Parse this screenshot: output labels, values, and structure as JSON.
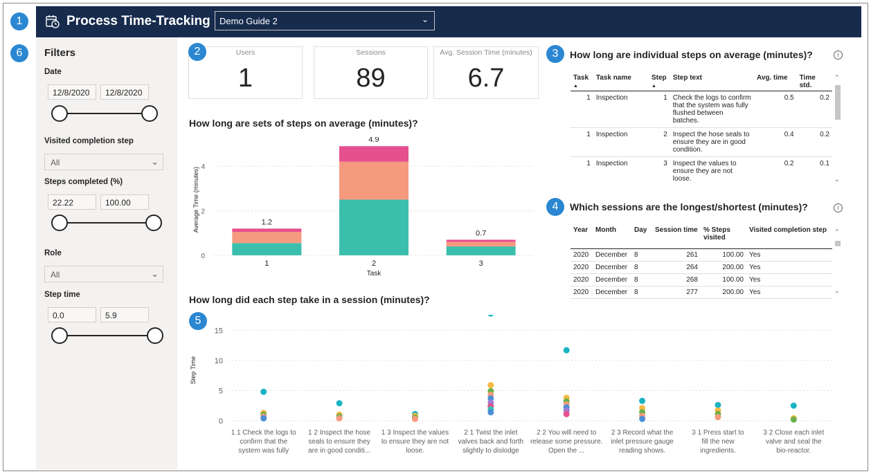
{
  "badges": [
    "1",
    "2",
    "3",
    "4",
    "5",
    "6"
  ],
  "header": {
    "title": "Process Time-Tracking",
    "guide_select": "Demo Guide 2",
    "icon": "calendar-clock-icon"
  },
  "filters": {
    "title": "Filters",
    "date": {
      "label": "Date",
      "from": "12/8/2020",
      "to": "12/8/2020"
    },
    "visited_completion_step": {
      "label": "Visited completion step",
      "value": "All"
    },
    "steps_completed": {
      "label": "Steps completed (%)",
      "from": "22.22",
      "to": "100.00"
    },
    "role": {
      "label": "Role",
      "value": "All"
    },
    "step_time": {
      "label": "Step time",
      "from": "0.0",
      "to": "5.9"
    }
  },
  "kpis": [
    {
      "label": "Users",
      "value": "1"
    },
    {
      "label": "Sessions",
      "value": "89"
    },
    {
      "label": "Avg. Session Time (minutes)",
      "value": "6.7"
    }
  ],
  "steps_table": {
    "title": "How long are individual steps on average (minutes)?",
    "columns": [
      "Task",
      "Task name",
      "Step",
      "Step text",
      "Avg. time",
      "Time std."
    ],
    "rows": [
      {
        "task": "1",
        "task_name": "Inspection",
        "step": "1",
        "step_text": "Check the logs to confirm that the system was fully flushed between batches.",
        "avg": "0.5",
        "std": "0.2"
      },
      {
        "task": "1",
        "task_name": "Inspection",
        "step": "2",
        "step_text": "Inspect the hose seals to ensure they are in good condition.",
        "avg": "0.4",
        "std": "0.2"
      },
      {
        "task": "1",
        "task_name": "Inspection",
        "step": "3",
        "step_text": "Inspect the values to ensure they are not loose.",
        "avg": "0.2",
        "std": "0.1"
      }
    ]
  },
  "sessions_table": {
    "title": "Which sessions are the longest/shortest (minutes)?",
    "columns": [
      "Year",
      "Month",
      "Day",
      "Session time",
      "% Steps visited",
      "Visited completion step"
    ],
    "rows": [
      {
        "year": "2020",
        "month": "December",
        "day": "8",
        "time": "261",
        "pct": "100.00",
        "visited": "Yes"
      },
      {
        "year": "2020",
        "month": "December",
        "day": "8",
        "time": "264",
        "pct": "200.00",
        "visited": "Yes"
      },
      {
        "year": "2020",
        "month": "December",
        "day": "8",
        "time": "268",
        "pct": "100.00",
        "visited": "Yes"
      },
      {
        "year": "2020",
        "month": "December",
        "day": "8",
        "time": "277",
        "pct": "200.00",
        "visited": "Yes"
      }
    ]
  },
  "colors": {
    "teal": "#3bbfad",
    "salmon": "#f59a7e",
    "pink": "#e6508f",
    "orange": "#f5b942",
    "blue": "#4a8fd6",
    "purple": "#9b7fd4",
    "green": "#6ab04c",
    "cyan": "#1ab3c4"
  },
  "chart_data": [
    {
      "type": "bar",
      "title": "How long are sets of steps on average (minutes)?",
      "xlabel": "Task",
      "ylabel": "Average Time (minutes)",
      "categories": [
        "1",
        "2",
        "3"
      ],
      "totals": [
        "1.2",
        "4.9",
        "0.7"
      ],
      "ylim": [
        0,
        5
      ],
      "yticks": [
        "0",
        "2",
        "4"
      ],
      "series": [
        {
          "values": [
            0.55,
            2.5,
            0.4
          ]
        },
        {
          "values": [
            0.5,
            1.7,
            0.2
          ]
        },
        {
          "values": [
            0.15,
            0.7,
            0.1
          ]
        }
      ]
    },
    {
      "type": "scatter",
      "title": "How long did each step take in a session (minutes)?",
      "ylabel": "Step Time",
      "ylim": [
        0,
        17
      ],
      "yticks": [
        "0",
        "5",
        "10",
        "15"
      ],
      "categories": [
        "1 1 Check the logs to confirm that the system was fully flu...",
        "1 2 Inspect the hose seals to ensure they are in good conditi...",
        "1 3 Inspect the values to ensure they are not loose.",
        "2 1 Twist the inlet valves back and forth slightly to dislodge ...",
        "2 2 You will need to release some pressure. Open the ...",
        "2 3 Record what the inlet pressure gauge reading shows.",
        "3 1 Press start to fill the new ingredients.",
        "3 2 Close each inlet valve and seal the bio-reactor."
      ],
      "points": [
        [
          4.8,
          1.3,
          1.0,
          0.7,
          0.4
        ],
        [
          2.9,
          1.0,
          0.7,
          0.4
        ],
        [
          1.1,
          0.8,
          0.5,
          0.3
        ],
        [
          17.8,
          5.9,
          4.9,
          4.3,
          3.7,
          3.0,
          2.4,
          1.9,
          1.4
        ],
        [
          11.7,
          3.8,
          3.2,
          2.7,
          2.2,
          1.7,
          1.1
        ],
        [
          3.3,
          2.1,
          1.4,
          0.8,
          0.3
        ],
        [
          2.6,
          1.7,
          1.1,
          0.6
        ],
        [
          2.5,
          0.4,
          0.2
        ]
      ]
    }
  ]
}
